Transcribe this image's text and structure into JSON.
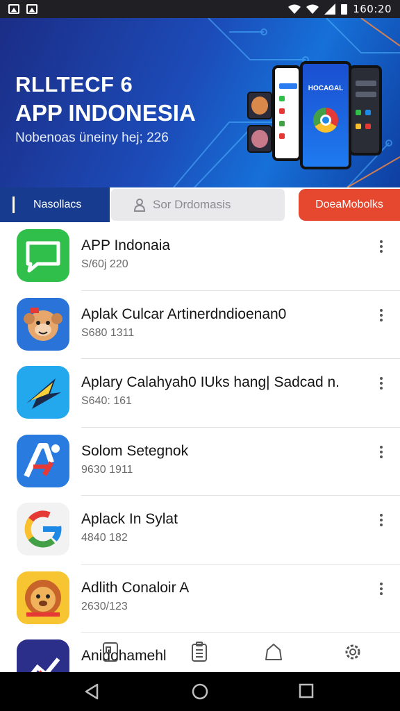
{
  "status_bar": {
    "time": "160:20",
    "icons": [
      "image-icon",
      "image-icon",
      "wifi-icon",
      "signal-icon",
      "battery-icon"
    ]
  },
  "banner": {
    "title_line1": "RLLTECF 6",
    "title_line2": "APP INDONESIA",
    "subtitle": "Nobenoas üneiny hej; 226",
    "phone_label": "HOCAGAL"
  },
  "tabs": {
    "left_label": "Nasollacs",
    "search_placeholder": "Sor Drdomasis",
    "cta_label": "DoeaMobolks"
  },
  "apps": [
    {
      "name": "APP Indonaia",
      "meta": "S/60j 220",
      "icon": "chat-bubble-icon",
      "bg": "#2fbf4a"
    },
    {
      "name": "Aplak Culcar Artinerdndioenan0",
      "meta": "S680 1311",
      "icon": "monkey-mascot-icon",
      "bg": "#2a73d8"
    },
    {
      "name": "Aplary Calahyah0 IUks hang| Sadcad n.",
      "meta": "S640: 161",
      "icon": "bird-icon",
      "bg": "#23a8ee"
    },
    {
      "name": "Solom Setegnok",
      "meta": "9630 1911",
      "icon": "letter-a-icon",
      "bg": "#2a7be0"
    },
    {
      "name": "Aplack In Sylat",
      "meta": "4840 182",
      "icon": "google-g-icon",
      "bg": "#f2f2f2"
    },
    {
      "name": "Adlith Conaloir A",
      "meta": "2630/123",
      "icon": "lion-mascot-icon",
      "bg": "#f7c531"
    },
    {
      "name": "Anidohamehl",
      "meta": "",
      "icon": "chart-icon",
      "bg": "#2b2f8a"
    }
  ],
  "bottom_icons": [
    "device-icon",
    "clipboard-icon",
    "bag-icon",
    "settings-icon"
  ],
  "nav": [
    "back-icon",
    "home-icon",
    "recents-icon"
  ],
  "colors": {
    "banner_blue": "#1c4bb8",
    "tab_navy": "#163b8f",
    "cta_red": "#e5482f"
  }
}
